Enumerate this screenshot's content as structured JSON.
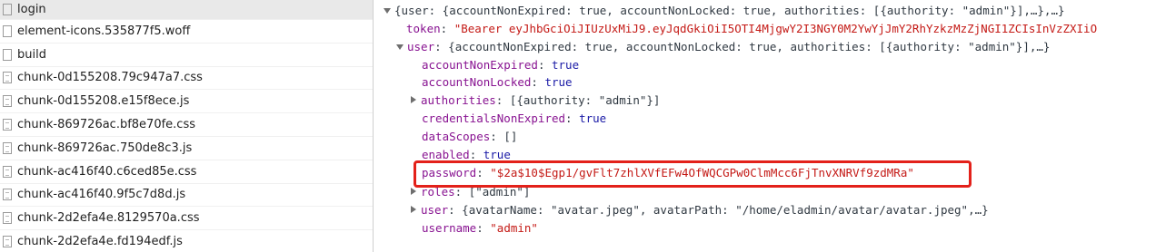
{
  "file_list": {
    "items": [
      {
        "name": "login",
        "icon": "doc-icon"
      },
      {
        "name": "element-icons.535877f5.woff",
        "icon": "doc-icon"
      },
      {
        "name": "build",
        "icon": "doc-icon"
      },
      {
        "name": "chunk-0d155208.79c947a7.css",
        "icon": "doc-icon"
      },
      {
        "name": "chunk-0d155208.e15f8ece.js",
        "icon": "doc-icon"
      },
      {
        "name": "chunk-869726ac.bf8e70fe.css",
        "icon": "doc-icon"
      },
      {
        "name": "chunk-869726ac.750de8c3.js",
        "icon": "doc-icon"
      },
      {
        "name": "chunk-ac416f40.c6ced85e.css",
        "icon": "doc-icon"
      },
      {
        "name": "chunk-ac416f40.9f5c7d8d.js",
        "icon": "doc-icon"
      },
      {
        "name": "chunk-2d2efa4e.8129570a.css",
        "icon": "doc-icon"
      },
      {
        "name": "chunk-2d2efa4e.fd194edf.js",
        "icon": "doc-icon"
      }
    ]
  },
  "preview": {
    "root_summary": "{user: {accountNonExpired: true, accountNonLocked: true, authorities: [{authority: \"admin\"}],…},…}",
    "token": {
      "key": "token",
      "value": "\"Bearer eyJhbGciOiJIUzUxMiJ9.eyJqdGkiOiI5OTI4MjgwY2I3NGY0M2YwYjJmY2RhYzkzMzZjNGI1ZCIsInVzZXIiO"
    },
    "user": {
      "key": "user",
      "summary": "{accountNonExpired: true, accountNonLocked: true, authorities: [{authority: \"admin\"}],…}",
      "accountNonExpired": {
        "key": "accountNonExpired",
        "value": "true"
      },
      "accountNonLocked": {
        "key": "accountNonLocked",
        "value": "true"
      },
      "authorities": {
        "key": "authorities",
        "value": "[{authority: \"admin\"}]"
      },
      "credentialsNonExpired": {
        "key": "credentialsNonExpired",
        "value": "true"
      },
      "dataScopes": {
        "key": "dataScopes",
        "value": "[]"
      },
      "enabled": {
        "key": "enabled",
        "value": "true"
      },
      "password": {
        "key": "password",
        "value": "\"$2a$10$Egp1/gvFlt7zhlXVfEFw4OfWQCGPw0ClmMcc6FjTnvXNRVf9zdMRa\""
      },
      "roles": {
        "key": "roles",
        "value": "[\"admin\"]"
      },
      "user": {
        "key": "user",
        "value": "{avatarName: \"avatar.jpeg\", avatarPath: \"/home/eladmin/avatar/avatar.jpeg\",…}"
      },
      "username": {
        "key": "username",
        "value": "\"admin\""
      }
    }
  },
  "colors": {
    "highlight": "#e3211a",
    "key": "#881391",
    "string": "#c41a16",
    "boolean": "#1a1aa6",
    "selected_row": "#e9e9e9"
  }
}
